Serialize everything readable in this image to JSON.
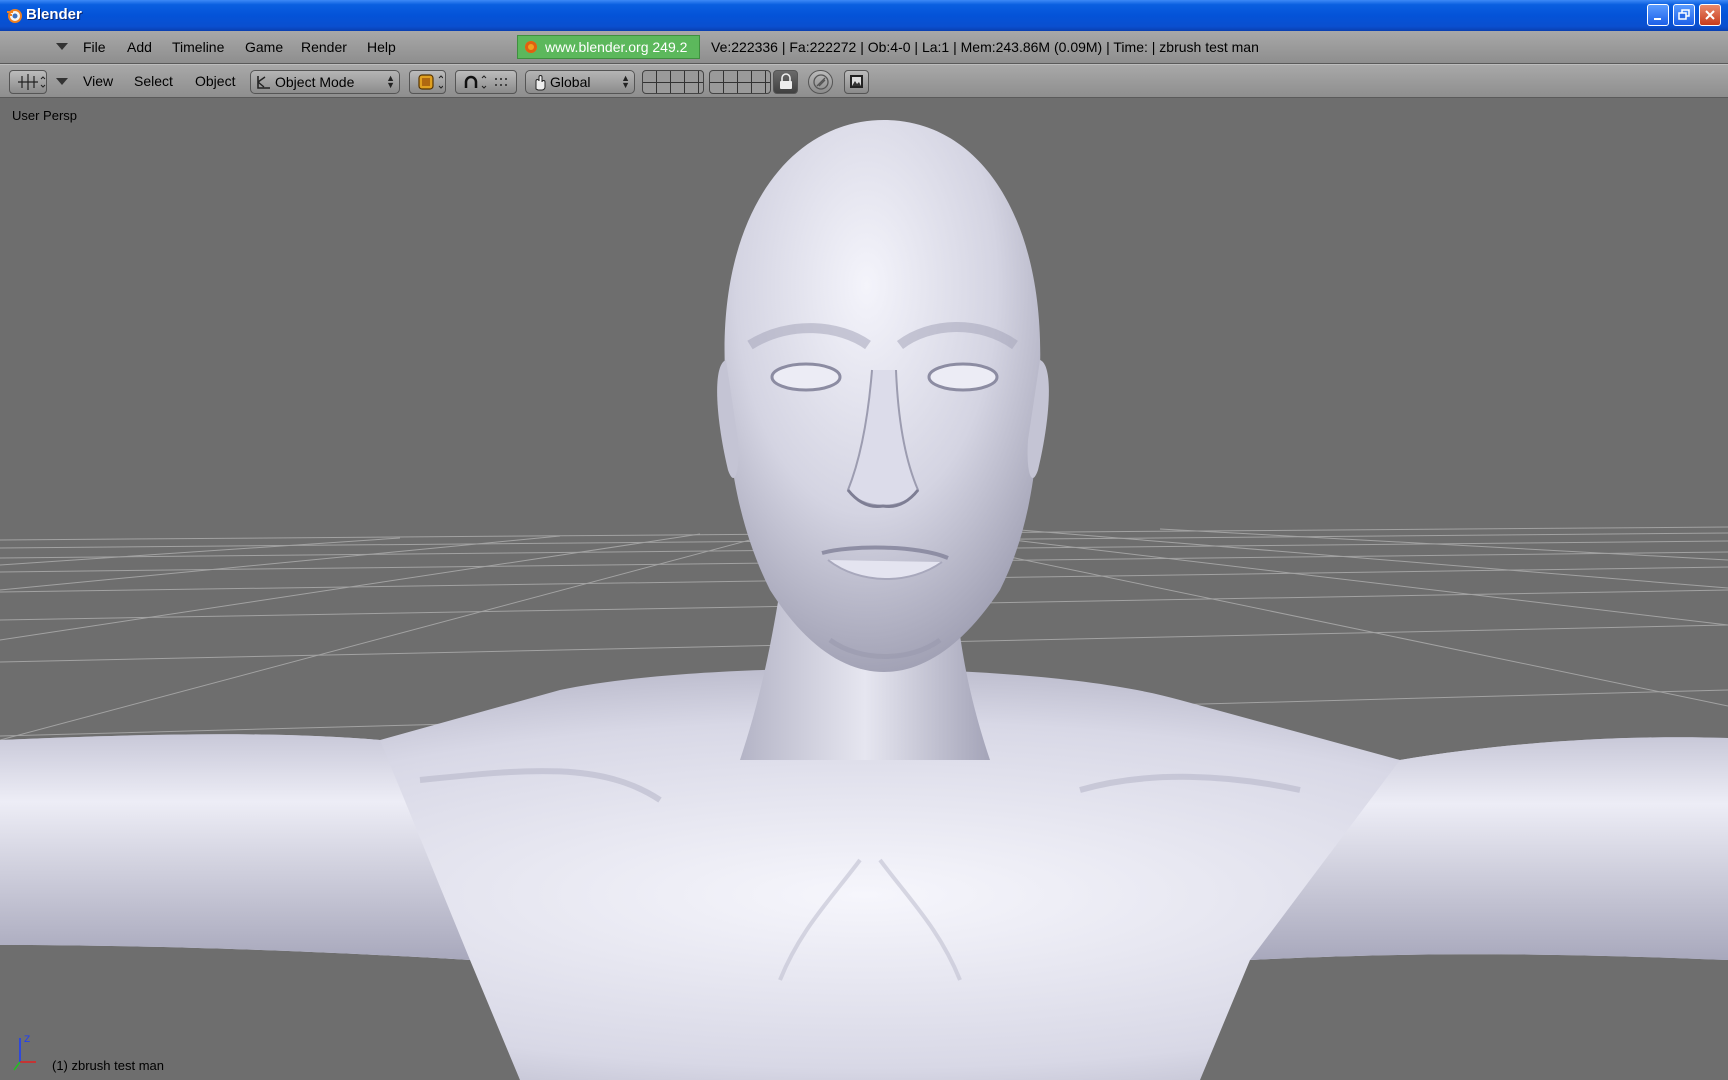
{
  "window": {
    "title": "Blender"
  },
  "menubar": {
    "items": [
      "File",
      "Add",
      "Timeline",
      "Game",
      "Render",
      "Help"
    ],
    "version_badge": "www.blender.org 249.2",
    "stats": "Ve:222336 | Fa:222272 | Ob:4-0 | La:1  | Mem:243.86M (0.09M)  | Time: | zbrush test man"
  },
  "toolbar": {
    "menus": [
      "View",
      "Select",
      "Object"
    ],
    "mode_select": "Object Mode",
    "orientation_select": "Global"
  },
  "viewport": {
    "view_label": "User Persp",
    "object_label": "(1) zbrush test man"
  },
  "colors": {
    "titlebar": "#0453d8",
    "header_bg": "#999999",
    "viewport_bg": "#6e6e6e",
    "version_badge": "#5cb85c",
    "model_color": "#d8d8e6"
  }
}
